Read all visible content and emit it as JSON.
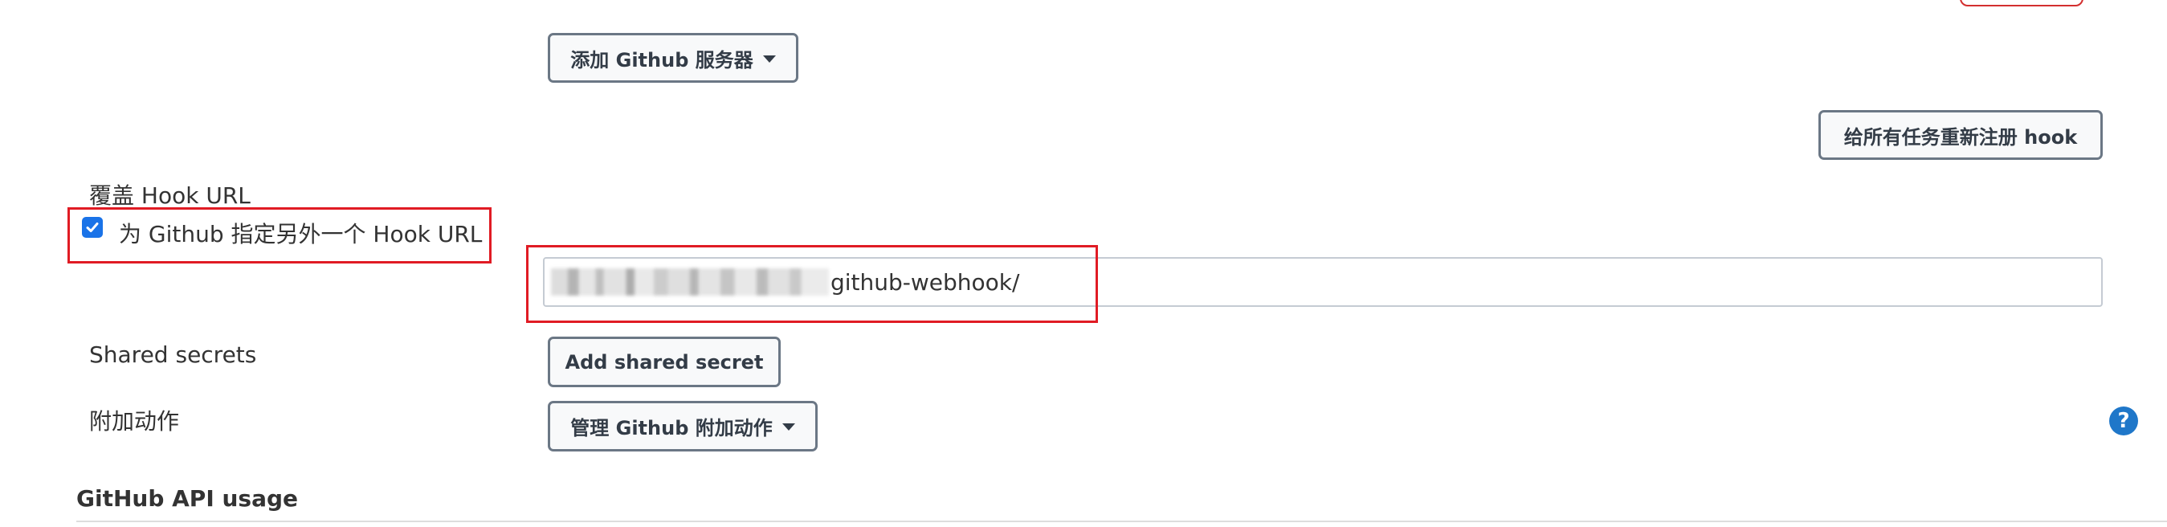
{
  "github_servers": {
    "add_button_label": "添加 Github 服务器"
  },
  "reregister_hooks": {
    "button_label": "给所有任务重新注册 hook"
  },
  "override_hook_url": {
    "section_label": "覆盖 Hook URL",
    "checkbox_label": "为 Github 指定另外一个 Hook URL",
    "checked": true,
    "url_visible_text": "github-webhook/"
  },
  "shared_secrets": {
    "label": "Shared secrets",
    "add_button_label": "Add shared secret"
  },
  "additional_actions": {
    "label": "附加动作",
    "manage_button_label": "管理 Github 附加动作"
  },
  "help": {
    "glyph": "?"
  },
  "github_api_usage": {
    "title": "GitHub API usage"
  },
  "colors": {
    "highlight_red": "#e01b24",
    "checkbox_blue": "#1a73e8",
    "help_blue": "#1f77c9",
    "button_border": "#6b7785"
  }
}
